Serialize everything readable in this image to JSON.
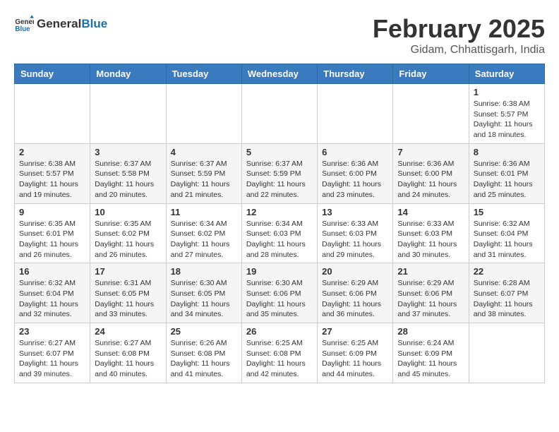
{
  "logo": {
    "text_general": "General",
    "text_blue": "Blue"
  },
  "title": {
    "month": "February 2025",
    "location": "Gidam, Chhattisgarh, India"
  },
  "weekdays": [
    "Sunday",
    "Monday",
    "Tuesday",
    "Wednesday",
    "Thursday",
    "Friday",
    "Saturday"
  ],
  "weeks": [
    [
      {
        "day": "",
        "info": ""
      },
      {
        "day": "",
        "info": ""
      },
      {
        "day": "",
        "info": ""
      },
      {
        "day": "",
        "info": ""
      },
      {
        "day": "",
        "info": ""
      },
      {
        "day": "",
        "info": ""
      },
      {
        "day": "1",
        "info": "Sunrise: 6:38 AM\nSunset: 5:57 PM\nDaylight: 11 hours and 18 minutes."
      }
    ],
    [
      {
        "day": "2",
        "info": "Sunrise: 6:38 AM\nSunset: 5:57 PM\nDaylight: 11 hours and 19 minutes."
      },
      {
        "day": "3",
        "info": "Sunrise: 6:37 AM\nSunset: 5:58 PM\nDaylight: 11 hours and 20 minutes."
      },
      {
        "day": "4",
        "info": "Sunrise: 6:37 AM\nSunset: 5:59 PM\nDaylight: 11 hours and 21 minutes."
      },
      {
        "day": "5",
        "info": "Sunrise: 6:37 AM\nSunset: 5:59 PM\nDaylight: 11 hours and 22 minutes."
      },
      {
        "day": "6",
        "info": "Sunrise: 6:36 AM\nSunset: 6:00 PM\nDaylight: 11 hours and 23 minutes."
      },
      {
        "day": "7",
        "info": "Sunrise: 6:36 AM\nSunset: 6:00 PM\nDaylight: 11 hours and 24 minutes."
      },
      {
        "day": "8",
        "info": "Sunrise: 6:36 AM\nSunset: 6:01 PM\nDaylight: 11 hours and 25 minutes."
      }
    ],
    [
      {
        "day": "9",
        "info": "Sunrise: 6:35 AM\nSunset: 6:01 PM\nDaylight: 11 hours and 26 minutes."
      },
      {
        "day": "10",
        "info": "Sunrise: 6:35 AM\nSunset: 6:02 PM\nDaylight: 11 hours and 26 minutes."
      },
      {
        "day": "11",
        "info": "Sunrise: 6:34 AM\nSunset: 6:02 PM\nDaylight: 11 hours and 27 minutes."
      },
      {
        "day": "12",
        "info": "Sunrise: 6:34 AM\nSunset: 6:03 PM\nDaylight: 11 hours and 28 minutes."
      },
      {
        "day": "13",
        "info": "Sunrise: 6:33 AM\nSunset: 6:03 PM\nDaylight: 11 hours and 29 minutes."
      },
      {
        "day": "14",
        "info": "Sunrise: 6:33 AM\nSunset: 6:03 PM\nDaylight: 11 hours and 30 minutes."
      },
      {
        "day": "15",
        "info": "Sunrise: 6:32 AM\nSunset: 6:04 PM\nDaylight: 11 hours and 31 minutes."
      }
    ],
    [
      {
        "day": "16",
        "info": "Sunrise: 6:32 AM\nSunset: 6:04 PM\nDaylight: 11 hours and 32 minutes."
      },
      {
        "day": "17",
        "info": "Sunrise: 6:31 AM\nSunset: 6:05 PM\nDaylight: 11 hours and 33 minutes."
      },
      {
        "day": "18",
        "info": "Sunrise: 6:30 AM\nSunset: 6:05 PM\nDaylight: 11 hours and 34 minutes."
      },
      {
        "day": "19",
        "info": "Sunrise: 6:30 AM\nSunset: 6:06 PM\nDaylight: 11 hours and 35 minutes."
      },
      {
        "day": "20",
        "info": "Sunrise: 6:29 AM\nSunset: 6:06 PM\nDaylight: 11 hours and 36 minutes."
      },
      {
        "day": "21",
        "info": "Sunrise: 6:29 AM\nSunset: 6:06 PM\nDaylight: 11 hours and 37 minutes."
      },
      {
        "day": "22",
        "info": "Sunrise: 6:28 AM\nSunset: 6:07 PM\nDaylight: 11 hours and 38 minutes."
      }
    ],
    [
      {
        "day": "23",
        "info": "Sunrise: 6:27 AM\nSunset: 6:07 PM\nDaylight: 11 hours and 39 minutes."
      },
      {
        "day": "24",
        "info": "Sunrise: 6:27 AM\nSunset: 6:08 PM\nDaylight: 11 hours and 40 minutes."
      },
      {
        "day": "25",
        "info": "Sunrise: 6:26 AM\nSunset: 6:08 PM\nDaylight: 11 hours and 41 minutes."
      },
      {
        "day": "26",
        "info": "Sunrise: 6:25 AM\nSunset: 6:08 PM\nDaylight: 11 hours and 42 minutes."
      },
      {
        "day": "27",
        "info": "Sunrise: 6:25 AM\nSunset: 6:09 PM\nDaylight: 11 hours and 44 minutes."
      },
      {
        "day": "28",
        "info": "Sunrise: 6:24 AM\nSunset: 6:09 PM\nDaylight: 11 hours and 45 minutes."
      },
      {
        "day": "",
        "info": ""
      }
    ]
  ]
}
